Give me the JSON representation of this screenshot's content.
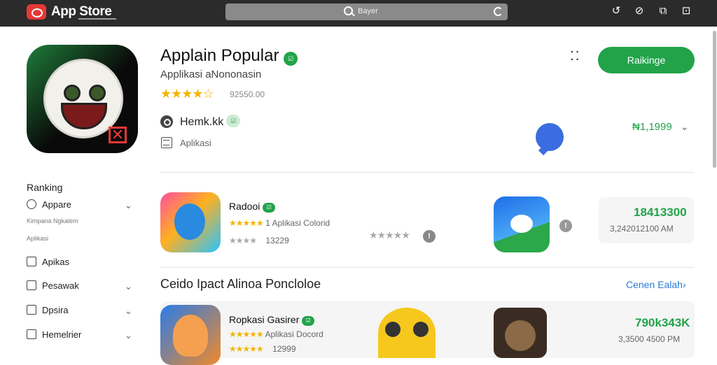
{
  "topbar": {
    "brand": "App Store",
    "brand_sub": "▬▬▬▬▬▬▬▬▬",
    "search_placeholder": "Bayer",
    "icons": [
      "back-arrow-icon",
      "compass-icon",
      "share-icon",
      "window-icon"
    ]
  },
  "hero": {
    "title": "Applain Popular",
    "title_badge": "☑",
    "subtitle": "Applikasi aNononasin",
    "stars": "★★★★☆",
    "rating_count": "92550.00",
    "developer": "Hemk.kk",
    "developer_badge": "☑",
    "category": "Aplikasi",
    "get_label": "Raikinge",
    "price": "₦1,1999",
    "chevron": "⌄"
  },
  "sidebar": {
    "title": "Ranking",
    "items": [
      {
        "label": "Appare",
        "icon": "app-icon",
        "chevron": true
      },
      {
        "label": "Kimpana Ngkalem",
        "sub": true
      },
      {
        "label": "Aplikasi",
        "sub": true
      },
      {
        "label": "Apikas",
        "icon": "grid-icon",
        "chevron": false
      },
      {
        "label": "Pesawak",
        "icon": "image-icon",
        "chevron": true
      },
      {
        "label": "Dpsira",
        "icon": "folder-icon",
        "chevron": true
      },
      {
        "label": "Hemelrier",
        "icon": "calendar-icon",
        "chevron": true
      }
    ]
  },
  "rows": [
    {
      "name": "Radooi",
      "badge": "☑",
      "stars": "★★★★★",
      "rating_text": "1 Aplikasi Colorid",
      "stars2": "★★★★",
      "rating2": "13229",
      "mid_stars": "★★★★★",
      "info": "!",
      "price": "18413300",
      "date": "3,242012100 AM"
    },
    {
      "name": "Ropkasi Gasirer",
      "badge": "☑",
      "stars": "★★★★★",
      "rating_text": "Aplikasi Docord",
      "stars2": "★★★★★",
      "rating2": "12999",
      "price": "790k343K",
      "date": "3,3500 4500 PM"
    }
  ],
  "section": {
    "title": "Ceido Ipact Alinoa Poncloloe",
    "see_all": "Cenen Ealah›"
  },
  "colors": {
    "accent": "#22a34a",
    "topbar": "#2b2b2b",
    "link": "#2a7bd8",
    "star": "#f4b400"
  }
}
